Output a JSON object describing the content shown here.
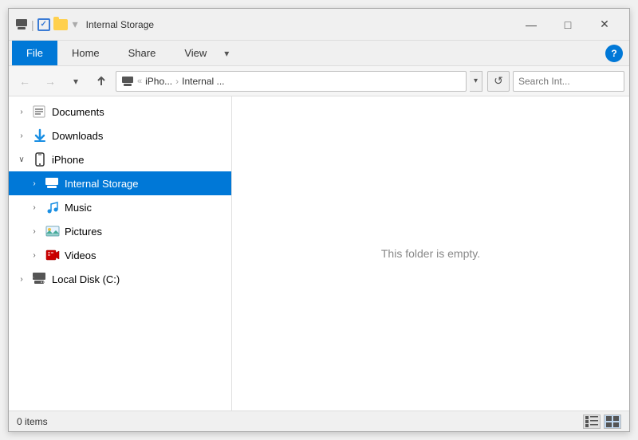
{
  "window": {
    "title": "Internal Storage",
    "controls": {
      "minimize": "—",
      "maximize": "□",
      "close": "✕"
    }
  },
  "ribbon": {
    "tabs": [
      "File",
      "Home",
      "Share",
      "View"
    ],
    "active_tab": "File",
    "help_label": "?"
  },
  "address_bar": {
    "back_btn": "←",
    "forward_btn": "→",
    "up_btn": "↑",
    "path_drive": "iPhо...",
    "path_separator": "›",
    "path_folder": "Internal ...",
    "refresh_btn": "↺",
    "search_placeholder": "Search Int...",
    "search_icon": "🔍"
  },
  "sidebar": {
    "items": [
      {
        "id": "documents",
        "label": "Documents",
        "level": 0,
        "expanded": false,
        "selected": false,
        "icon": "documents-icon"
      },
      {
        "id": "downloads",
        "label": "Downloads",
        "level": 0,
        "expanded": false,
        "selected": false,
        "icon": "downloads-icon"
      },
      {
        "id": "iphone",
        "label": "iPhone",
        "level": 0,
        "expanded": true,
        "selected": false,
        "icon": "phone-icon"
      },
      {
        "id": "internal-storage",
        "label": "Internal Storage",
        "level": 1,
        "expanded": false,
        "selected": true,
        "icon": "storage-icon"
      },
      {
        "id": "music",
        "label": "Music",
        "level": 1,
        "expanded": false,
        "selected": false,
        "icon": "music-icon"
      },
      {
        "id": "pictures",
        "label": "Pictures",
        "level": 1,
        "expanded": false,
        "selected": false,
        "icon": "pictures-icon"
      },
      {
        "id": "videos",
        "label": "Videos",
        "level": 1,
        "expanded": false,
        "selected": false,
        "icon": "videos-icon"
      },
      {
        "id": "local-disk",
        "label": "Local Disk (C:)",
        "level": 0,
        "expanded": false,
        "selected": false,
        "icon": "disk-icon"
      }
    ]
  },
  "content": {
    "empty_message": "This folder is empty."
  },
  "status_bar": {
    "items_count": "0 items"
  }
}
